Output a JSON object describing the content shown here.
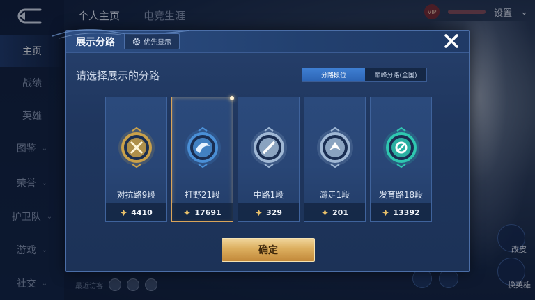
{
  "nav": {
    "tabs": [
      "个人主页",
      "电竞生涯"
    ],
    "settings_label": "设置",
    "vip_label": "VIP"
  },
  "sidebar": {
    "items": [
      {
        "label": "主页",
        "active": true,
        "chevron": false
      },
      {
        "label": "战绩",
        "active": false,
        "chevron": false
      },
      {
        "label": "英雄",
        "active": false,
        "chevron": false
      },
      {
        "label": "图鉴",
        "active": false,
        "chevron": true
      },
      {
        "label": "荣誉",
        "active": false,
        "chevron": true
      },
      {
        "label": "护卫队",
        "active": false,
        "chevron": true
      },
      {
        "label": "游戏",
        "active": false,
        "chevron": true
      },
      {
        "label": "社交",
        "active": false,
        "chevron": true
      }
    ]
  },
  "background": {
    "recent_visitors_label": "最近访客",
    "right_labels": [
      "改皮",
      "换英雄"
    ]
  },
  "modal": {
    "title": "展示分路",
    "priority_button": "优先显示",
    "subtitle": "请选择展示的分路",
    "toggle": [
      {
        "label": "分路段位",
        "active": true
      },
      {
        "label": "巅峰分路(全国)",
        "active": false
      }
    ],
    "cards": [
      {
        "name": "对抗路9段",
        "score": "4410",
        "selected": false,
        "emblem": "clash-lane-emblem-icon",
        "color": "#c9a04a"
      },
      {
        "name": "打野21段",
        "score": "17691",
        "selected": true,
        "emblem": "jungle-emblem-icon",
        "color": "#4a8fd6"
      },
      {
        "name": "中路1段",
        "score": "329",
        "selected": false,
        "emblem": "mid-lane-emblem-icon",
        "color": "#9fb7d4"
      },
      {
        "name": "游走1段",
        "score": "201",
        "selected": false,
        "emblem": "roam-emblem-icon",
        "color": "#9fb7d4"
      },
      {
        "name": "发育路18段",
        "score": "13392",
        "selected": false,
        "emblem": "farm-lane-emblem-icon",
        "color": "#2fc7b0"
      }
    ],
    "confirm_button": "确定"
  },
  "colors": {
    "accent_gold": "#dcae5e",
    "toggle_active": "#3f7fd2",
    "modal_bg": "#22406f"
  }
}
